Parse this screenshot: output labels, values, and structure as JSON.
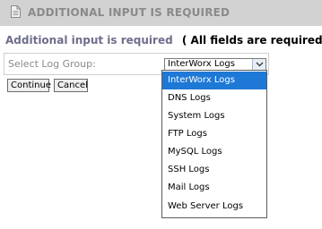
{
  "header": {
    "title": "ADDITIONAL INPUT IS REQUIRED",
    "icon": "document-icon"
  },
  "subheading": {
    "lead": "Additional input is required",
    "note": "( All fields are required )"
  },
  "form": {
    "label": "Select Log Group:",
    "selected_value": "InterWorx Logs"
  },
  "buttons": {
    "continue": "Continue",
    "cancel": "Cancel"
  },
  "dropdown": {
    "options": [
      "InterWorx Logs",
      "DNS Logs",
      "System Logs",
      "FTP Logs",
      "MySQL Logs",
      "SSH Logs",
      "Mail Logs",
      "Web Server Logs"
    ],
    "highlighted_index": 0
  },
  "colors": {
    "header_bg": "#d2d2d2",
    "header_text": "#8a8a8a",
    "lead_text": "#6e6e8c",
    "highlight": "#1e78d6"
  }
}
